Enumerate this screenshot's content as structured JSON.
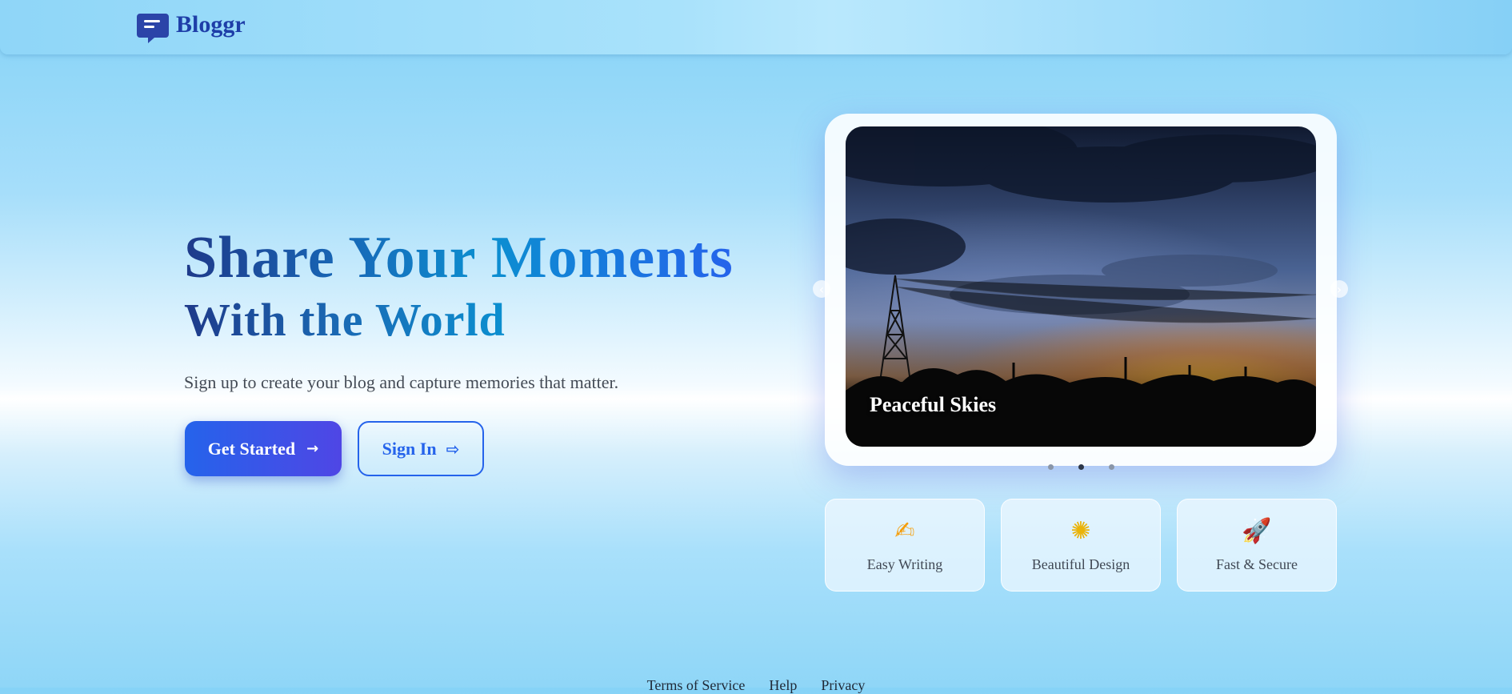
{
  "brand": {
    "name": "Bloggr",
    "icon": "chat-bubble-icon",
    "accent": "#1e3ea8"
  },
  "hero": {
    "title_line1": "Share Your Moments",
    "title_line2": "With the World",
    "subtitle": "Sign up to create your blog and capture memories that matter."
  },
  "actions": {
    "primary": {
      "label": "Get Started",
      "icon": "arrow-right-icon",
      "glyph": "→"
    },
    "secondary": {
      "label": "Sign In",
      "icon": "sign-in-hand-icon",
      "glyph": "⇨"
    }
  },
  "carousel": {
    "caption": "Peaceful Skies",
    "prev_glyph": "‹",
    "next_glyph": "›",
    "active_index": 2,
    "dot_count": 3
  },
  "features": [
    {
      "label": "Easy Writing",
      "icon": "writing-hand-icon",
      "glyph": "✍"
    },
    {
      "label": "Beautiful Design",
      "icon": "glowing-star-icon",
      "glyph": "✺"
    },
    {
      "label": "Fast & Secure",
      "icon": "rocket-icon",
      "glyph": "🚀"
    }
  ],
  "footer": {
    "links": [
      "Terms of Service",
      "Help",
      "Privacy"
    ]
  },
  "colors": {
    "primary_button": "#2563eb",
    "primary_button_end": "#4f46e5",
    "heading_dark": "#1e3a8a",
    "heading_light": "#0b8fd0"
  }
}
